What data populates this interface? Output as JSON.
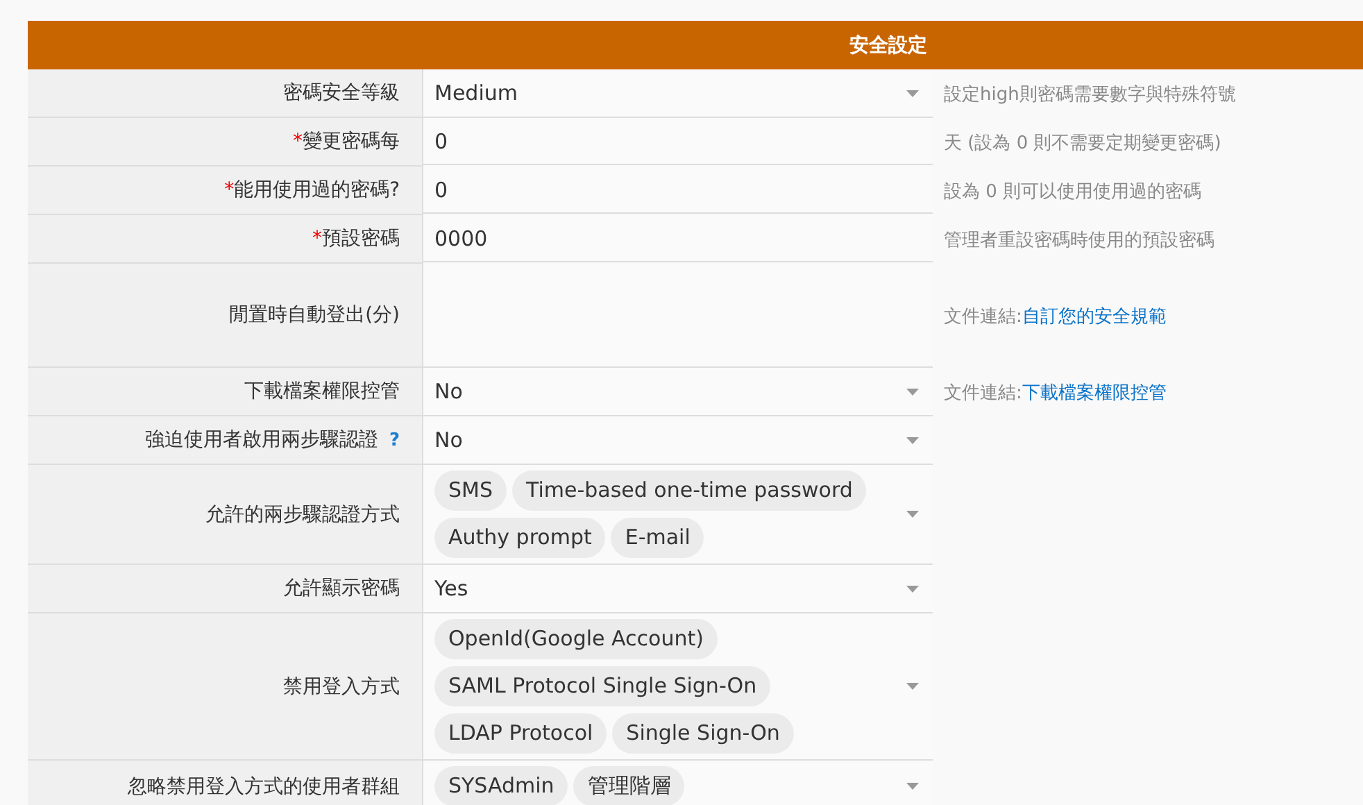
{
  "section": {
    "title": "安全設定"
  },
  "rows": [
    {
      "label": "密碼安全等級",
      "kind": "select",
      "value": "Medium",
      "help": {
        "text": "設定high則密碼需要數字與特殊符號"
      }
    },
    {
      "label": "變更密碼每",
      "required_mark": "*",
      "kind": "text",
      "value": "0",
      "help": {
        "text": "天 (設為 0 則不需要定期變更密碼)"
      }
    },
    {
      "label": "能用使用過的密碼?",
      "required_mark": "*",
      "kind": "text",
      "value": "0",
      "help": {
        "text": "設為 0 則可以使用使用過的密碼"
      }
    },
    {
      "label": "預設密碼",
      "required_mark": "*",
      "kind": "text",
      "value": "0000",
      "help": {
        "text": "管理者重設密碼時使用的預設密碼"
      }
    },
    {
      "label": "閒置時自動登出(分)",
      "kind": "empty",
      "help": {
        "text": "文件連結:",
        "link": "自訂您的安全規範"
      }
    },
    {
      "label": "下載檔案權限控管",
      "kind": "select",
      "value": "No",
      "help": {
        "text": "文件連結:",
        "link": "下載檔案權限控管"
      }
    },
    {
      "label": "強迫使用者啟用兩步驟認證",
      "help_icon": "?",
      "kind": "select",
      "value": "No"
    },
    {
      "label": "允許的兩步驟認證方式",
      "kind": "tags",
      "tags": [
        "SMS",
        "Time-based one-time password",
        "Authy prompt",
        "E-mail"
      ]
    },
    {
      "label": "允許顯示密碼",
      "kind": "select",
      "value": "Yes"
    },
    {
      "label": "禁用登入方式",
      "kind": "tags",
      "tags": [
        "OpenId(Google Account)",
        "SAML Protocol Single Sign-On",
        "LDAP Protocol",
        "Single Sign-On"
      ]
    },
    {
      "label": "忽略禁用登入方式的使用者群組",
      "kind": "tags",
      "tags": [
        "SYSAdmin",
        "管理階層"
      ]
    }
  ]
}
